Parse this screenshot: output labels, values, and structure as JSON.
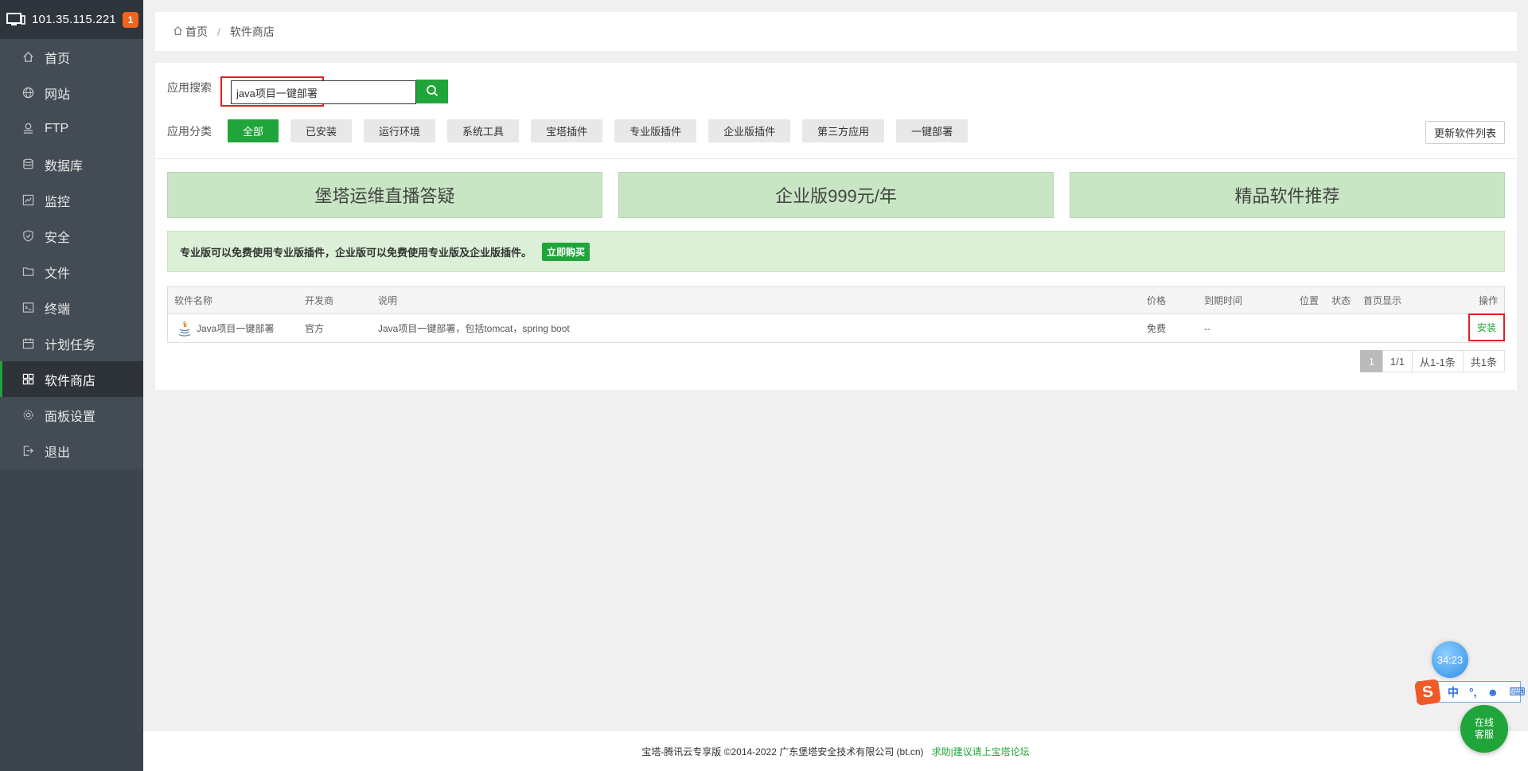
{
  "sidebar": {
    "server_ip": "101.35.115.221",
    "notification_count": "1",
    "items": [
      {
        "label": "首页",
        "icon": "home-icon"
      },
      {
        "label": "网站",
        "icon": "globe-icon"
      },
      {
        "label": "FTP",
        "icon": "ftp-icon"
      },
      {
        "label": "数据库",
        "icon": "database-icon"
      },
      {
        "label": "监控",
        "icon": "monitor-icon"
      },
      {
        "label": "安全",
        "icon": "shield-icon"
      },
      {
        "label": "文件",
        "icon": "folder-icon"
      },
      {
        "label": "终端",
        "icon": "terminal-icon"
      },
      {
        "label": "计划任务",
        "icon": "calendar-icon"
      },
      {
        "label": "软件商店",
        "icon": "apps-icon"
      },
      {
        "label": "面板设置",
        "icon": "gear-icon"
      },
      {
        "label": "退出",
        "icon": "logout-icon"
      }
    ],
    "active": "软件商店"
  },
  "breadcrumb": {
    "home": "首页",
    "separator": "/",
    "current": "软件商店"
  },
  "search": {
    "label": "应用搜索",
    "value": "java项目一键部署"
  },
  "categories": {
    "label": "应用分类",
    "items": [
      "全部",
      "已安装",
      "运行环境",
      "系统工具",
      "宝塔插件",
      "专业版插件",
      "企业版插件",
      "第三方应用",
      "一键部署"
    ],
    "active": "全部",
    "refresh_label": "更新软件列表"
  },
  "banners": [
    "堡塔运维直播答疑",
    "企业版999元/年",
    "精品软件推荐"
  ],
  "notice": {
    "text": "专业版可以免费使用专业版插件，企业版可以免费使用专业版及企业版插件。",
    "buy_label": "立即购买"
  },
  "table": {
    "headers": {
      "name": "软件名称",
      "developer": "开发商",
      "desc": "说明",
      "price": "价格",
      "expire": "到期时间",
      "position": "位置",
      "status": "状态",
      "homepage": "首页显示",
      "action": "操作"
    },
    "rows": [
      {
        "name": "Java项目一键部署",
        "developer": "官方",
        "desc": "Java项目一键部署，包括tomcat，spring boot",
        "price": "免费",
        "expire": "--",
        "action": "安装"
      }
    ]
  },
  "pagination": {
    "current": "1",
    "pages": "1/1",
    "range": "从1-1条",
    "total": "共1条"
  },
  "footer": {
    "copyright": "宝塔-腾讯云专享版 ©2014-2022 广东堡塔安全技术有限公司 (bt.cn)",
    "link": "求助|建议请上宝塔论坛"
  },
  "widgets": {
    "timer": "34:23",
    "ime_mode": "中",
    "online_service": [
      "在线",
      "客服"
    ]
  },
  "colors": {
    "accent": "#20a53a",
    "sidebar_bg": "#3c444d",
    "highlight_border": "#e02020"
  }
}
